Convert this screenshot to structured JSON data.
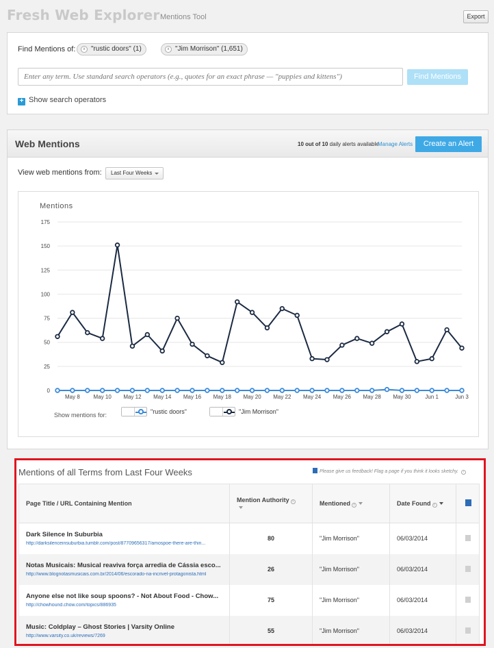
{
  "header": {
    "title": "Fresh Web Explorer",
    "subtitle": "Mentions Tool",
    "export_label": "Export"
  },
  "search": {
    "find_label": "Find Mentions of:",
    "tags": [
      "\"rustic doors\" (1)",
      "\"Jim Morrison\" (1,651)"
    ],
    "placeholder": "Enter any term. Use standard search operators (e.g., quotes for an exact phrase — \"puppies and kittens\")",
    "find_button": "Find Mentions",
    "show_operators": "Show search operators"
  },
  "web_mentions": {
    "title": "Web Mentions",
    "alerts_count": "10 out of 10",
    "alerts_suffix": " daily alerts available",
    "manage_alerts": "Manage Alerts",
    "create_alert": "Create an Alert",
    "view_label": "View web mentions from:",
    "range_selected": "Last Four Weeks",
    "legend_label": "Show mentions for:",
    "legend_items": [
      "\"rustic doors\"",
      "\"Jim Morrison\""
    ]
  },
  "chart_data": {
    "type": "line",
    "title": "Mentions",
    "ylim": [
      0,
      175
    ],
    "yticks": [
      0,
      25,
      50,
      75,
      100,
      125,
      150,
      175
    ],
    "x_labels": [
      "May 8",
      "May 10",
      "May 12",
      "May 14",
      "May 16",
      "May 18",
      "May 20",
      "May 22",
      "May 24",
      "May 26",
      "May 28",
      "May 30",
      "Jun 1",
      "Jun 3"
    ],
    "x": [
      "May 7",
      "May 8",
      "May 9",
      "May 10",
      "May 11",
      "May 12",
      "May 13",
      "May 14",
      "May 15",
      "May 16",
      "May 17",
      "May 18",
      "May 19",
      "May 20",
      "May 21",
      "May 22",
      "May 23",
      "May 24",
      "May 25",
      "May 26",
      "May 27",
      "May 28",
      "May 29",
      "May 30",
      "May 31",
      "Jun 1",
      "Jun 2",
      "Jun 3"
    ],
    "series": [
      {
        "name": "\"Jim Morrison\"",
        "color": "#1b2a42",
        "values": [
          56,
          81,
          60,
          54,
          151,
          46,
          58,
          41,
          75,
          48,
          36,
          29,
          92,
          81,
          65,
          85,
          78,
          33,
          32,
          47,
          54,
          49,
          61,
          69,
          30,
          33,
          63,
          44
        ]
      },
      {
        "name": "\"rustic doors\"",
        "color": "#3b8ad9",
        "values": [
          0,
          0,
          0,
          0,
          0,
          0,
          0,
          0,
          0,
          0,
          0,
          0,
          0,
          0,
          0,
          0,
          0,
          0,
          0,
          0,
          0,
          0,
          1,
          0,
          0,
          0,
          0,
          0
        ]
      }
    ]
  },
  "mentions_table": {
    "title": "Mentions of all Terms from Last Four Weeks",
    "feedback": "Please give us feedback! Flag a page if you think it looks sketchy.",
    "columns": [
      "Page Title / URL Containing Mention",
      "Mention Authority",
      "Mentioned",
      "Date Found"
    ],
    "rows": [
      {
        "title": "Dark Silence In Suburbia",
        "url": "http://darksilenceinsuburbia.tumblr.com/post/87709656317/amospoe-there-are-thin...",
        "authority": "80",
        "mentioned": "\"Jim Morrison\"",
        "date": "06/03/2014"
      },
      {
        "title": "Notas Musicais: Musical reaviva força arredia de Cássia esco...",
        "url": "http://www.blognotasmusicais.com.br/2014/06/escorado-na-incrivel-protagonista.html",
        "authority": "26",
        "mentioned": "\"Jim Morrison\"",
        "date": "06/03/2014"
      },
      {
        "title": "Anyone else not like soup spoons? - Not About Food - Chow...",
        "url": "http://chowhound.chow.com/topics/886935",
        "authority": "75",
        "mentioned": "\"Jim Morrison\"",
        "date": "06/03/2014"
      },
      {
        "title": "Music: Coldplay – Ghost Stories | Varsity Online",
        "url": "http://www.varsity.co.uk/reviews/7269",
        "authority": "55",
        "mentioned": "\"Jim Morrison\"",
        "date": "06/03/2014"
      }
    ]
  }
}
